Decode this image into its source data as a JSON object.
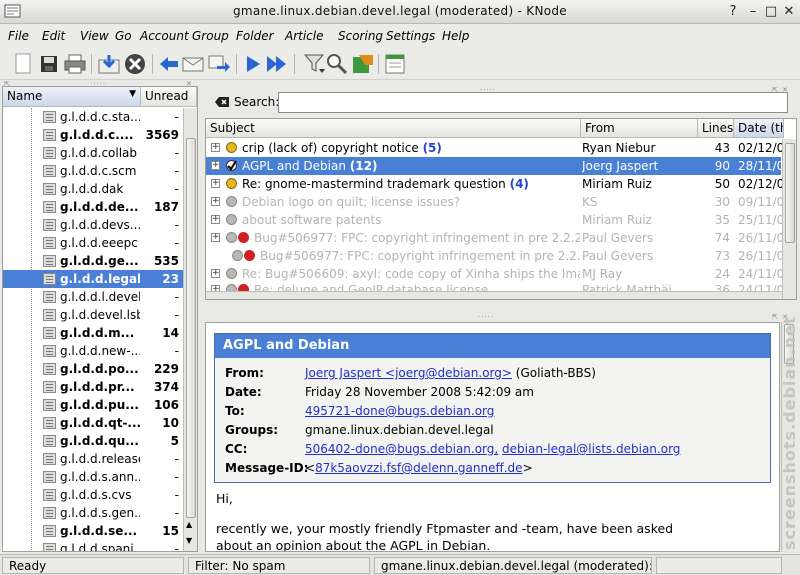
{
  "window": {
    "title": "gmane.linux.debian.devel.legal (moderated) - KNode",
    "buttons": [
      "help-icon",
      "minimize-icon",
      "maximize-icon",
      "close-icon"
    ]
  },
  "menu": [
    "File",
    "Edit",
    "View",
    "Go",
    "Account",
    "Group",
    "Folder",
    "Article",
    "Scoring",
    "Settings",
    "Help"
  ],
  "toolbar": {
    "icons": [
      "new-article-icon",
      "save-icon",
      "print-icon",
      "get-new-articles-icon",
      "cancel-icon",
      "reply-icon",
      "reply-author-icon",
      "forward-icon",
      "next-unread-icon",
      "next-unread-thread-icon",
      "filter-icon",
      "search-icon",
      "expire-icon",
      "notes-icon"
    ]
  },
  "folders": {
    "columns": {
      "name": "Name",
      "unread": "Unread"
    },
    "items": [
      {
        "name": "g.l.d.d.c.sta...",
        "unread": "-",
        "bold": false
      },
      {
        "name": "g.l.d.d.c....",
        "unread": "3569",
        "bold": true
      },
      {
        "name": "g.l.d.d.collab",
        "unread": "-",
        "bold": false
      },
      {
        "name": "g.l.d.d.c.scm",
        "unread": "-",
        "bold": false
      },
      {
        "name": "g.l.d.d.dak",
        "unread": "-",
        "bold": false
      },
      {
        "name": "g.l.d.d.de...",
        "unread": "187",
        "bold": true
      },
      {
        "name": "g.l.d.d.devs...",
        "unread": "-",
        "bold": false
      },
      {
        "name": "g.l.d.d.eeepc",
        "unread": "-",
        "bold": false
      },
      {
        "name": "g.l.d.d.ge...",
        "unread": "535",
        "bold": true
      },
      {
        "name": "g.l.d.d.legal",
        "unread": "23",
        "bold": true,
        "selected": true
      },
      {
        "name": "g.l.d.d.l.devel",
        "unread": "-",
        "bold": false
      },
      {
        "name": "g.l.d.devel.lsb",
        "unread": "-",
        "bold": false
      },
      {
        "name": "g.l.d.d.m...",
        "unread": "14",
        "bold": true
      },
      {
        "name": "g.l.d.d.new-...",
        "unread": "-",
        "bold": false
      },
      {
        "name": "g.l.d.d.po...",
        "unread": "229",
        "bold": true
      },
      {
        "name": "g.l.d.d.pr...",
        "unread": "374",
        "bold": true
      },
      {
        "name": "g.l.d.d.pu...",
        "unread": "106",
        "bold": true
      },
      {
        "name": "g.l.d.d.qt-...",
        "unread": "10",
        "bold": true
      },
      {
        "name": "g.l.d.d.qu...",
        "unread": "5",
        "bold": true
      },
      {
        "name": "g.l.d.d.release",
        "unread": "-",
        "bold": false
      },
      {
        "name": "g.l.d.d.s.ann...",
        "unread": "-",
        "bold": false
      },
      {
        "name": "g.l.d.d.s.cvs",
        "unread": "-",
        "bold": false
      },
      {
        "name": "g.l.d.d.s.gen...",
        "unread": "-",
        "bold": false
      },
      {
        "name": "g.l.d.d.se...",
        "unread": "15",
        "bold": true
      },
      {
        "name": "g.l.d.d.spani...",
        "unread": "-",
        "bold": false
      }
    ]
  },
  "search": {
    "label": "Search:",
    "value": ""
  },
  "articles": {
    "columns": {
      "subject": "Subject",
      "from": "From",
      "lines": "Lines",
      "date": "Date (th"
    },
    "rows": [
      {
        "subject": "crip (lack of) copyright notice",
        "count": "(5)",
        "from": "Ryan Niebur",
        "lines": "43",
        "date": "02/12/08",
        "state": "unread",
        "status": "yellow"
      },
      {
        "subject": "AGPL and Debian",
        "count": "(12)",
        "from": "Joerg Jaspert",
        "lines": "90",
        "date": "28/11/08",
        "state": "selected",
        "status": "check"
      },
      {
        "subject": "Re: gnome-mastermind trademark question",
        "count": "(4)",
        "from": "Miriam Ruiz",
        "lines": "50",
        "date": "02/12/08",
        "state": "unread",
        "status": "yellow"
      },
      {
        "subject": "Debian logo on quilt; license issues?",
        "count": "",
        "from": "KS",
        "lines": "30",
        "date": "09/11/08",
        "state": "read",
        "status": "gray"
      },
      {
        "subject": "about software patents",
        "count": "",
        "from": "Miriam Ruiz",
        "lines": "35",
        "date": "25/11/08",
        "state": "read",
        "status": "gray"
      },
      {
        "subject": "Bug#506977: FPC: copyright infringement in pre 2.2.2 s...",
        "count": "",
        "from": "Paul Gevers",
        "lines": "74",
        "date": "26/11/08",
        "state": "read",
        "status": "gray-red"
      },
      {
        "subject": "Bug#506977: FPC: copyright infringement in pre 2.2.2 s...",
        "count": "",
        "from": "Paul Gevers",
        "lines": "73",
        "date": "26/11/08",
        "state": "read",
        "status": "gray-red-indent"
      },
      {
        "subject": "Re: Bug#506609: axyl: code copy of Xinha ships the Imag...",
        "count": "",
        "from": "MJ Ray",
        "lines": "24",
        "date": "24/11/08",
        "state": "read",
        "status": "gray"
      },
      {
        "subject": "Re: deluge and GeoIP database license",
        "count": "",
        "from": "Patrick Matthäi",
        "lines": "36",
        "date": "24/11/08",
        "state": "read",
        "status": "gray-red"
      }
    ]
  },
  "message": {
    "subject": "AGPL and Debian",
    "from_label": "From:",
    "from_value": "Joerg Jaspert <joerg@debian.org>",
    "from_org": "(Goliath-BBS)",
    "date_label": "Date:",
    "date_value": "Friday 28 November 2008 5:42:09 am",
    "to_label": "To:",
    "to_value": "495721-done@bugs.debian.org",
    "groups_label": "Groups:",
    "groups_value": "gmane.linux.debian.devel.legal",
    "cc_label": "CC:",
    "cc_value1": "506402-done@bugs.debian.org,",
    "cc_value2": "debian-legal@lists.debian.org",
    "msgid_label": "Message-ID:",
    "msgid_open": "<",
    "msgid_value": "87k5aovzzi.fsf@delenn.ganneff.de",
    "msgid_close": ">",
    "body": [
      "Hi,",
      "recently we, your mostly friendly Ftpmaster and -team, have been asked",
      "about an opinion about the AGPL in Debian."
    ]
  },
  "status": {
    "ready": "Ready",
    "filter": "Filter: No spam",
    "group": "gmane.linux.debian.devel.legal (moderated): ..."
  },
  "watermark": "screenshots.debian.net",
  "colors": {
    "selection": "#4a7fd6",
    "link": "#2230c8",
    "thread_count": "#2a44c8"
  }
}
